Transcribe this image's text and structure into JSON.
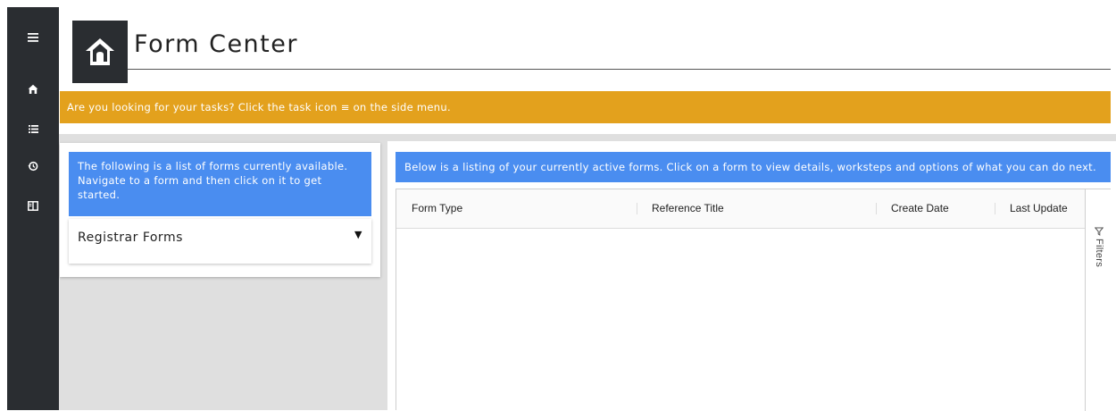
{
  "sidebar": {
    "items": [
      {
        "name": "menu-icon"
      },
      {
        "name": "home-icon"
      },
      {
        "name": "tasks-icon"
      },
      {
        "name": "history-icon"
      },
      {
        "name": "book-icon"
      }
    ]
  },
  "header": {
    "title": "Form Center",
    "icon": "home-icon"
  },
  "notice": {
    "text": "Are you looking for your tasks? Click the task icon ≡ on the side menu.",
    "color": "#e3a11d"
  },
  "left_panel": {
    "info": "The following is a list of forms currently available. Navigate to a form and then click on it to get started.",
    "dropdown_label": "Registrar Forms",
    "info_color": "#4a8df0"
  },
  "right_panel": {
    "info": "Below is a listing of your currently active forms. Click on a form to view details, worksteps and options of what you can do next.",
    "columns": [
      "Form Type",
      "Reference Title",
      "Create Date",
      "Last Update"
    ],
    "rows": [],
    "filters_label": "Filters",
    "filter_icon": "filter-icon"
  },
  "colors": {
    "sidebar": "#2a2d31",
    "accent_blue": "#4a8df0",
    "notice": "#e3a11d"
  }
}
